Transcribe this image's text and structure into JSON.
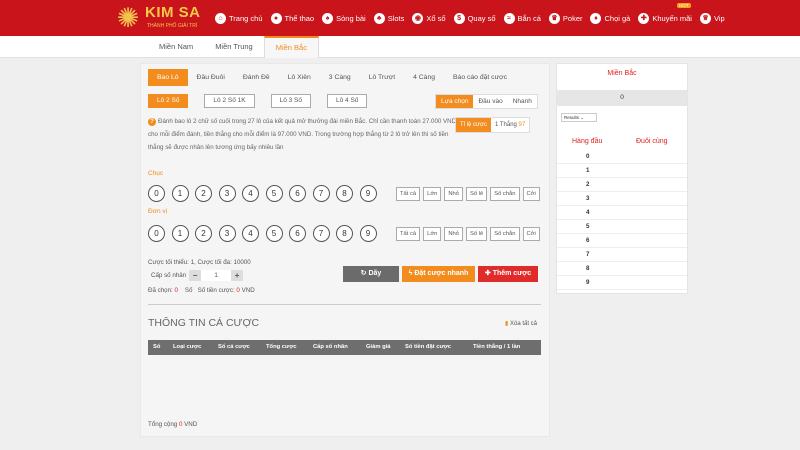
{
  "header": {
    "brand": "KIM SA",
    "tagline": "THÀNH PHỐ GIẢI TRÍ",
    "hot_badge": "HOT",
    "nav": [
      {
        "label": "Trang chủ",
        "icon": "home-icon"
      },
      {
        "label": "Thể thao",
        "icon": "soccer-ball-icon"
      },
      {
        "label": "Sòng bài",
        "icon": "cards-icon"
      },
      {
        "label": "Slots",
        "icon": "cherry-icon"
      },
      {
        "label": "Xổ số",
        "icon": "lottery-ball-icon"
      },
      {
        "label": "Quay số",
        "icon": "dollar-coin-icon"
      },
      {
        "label": "Bắn cá",
        "icon": "fish-icon"
      },
      {
        "label": "Poker",
        "icon": "crown-icon"
      },
      {
        "label": "Chọi gà",
        "icon": "rooster-icon"
      },
      {
        "label": "Khuyến mãi",
        "icon": "gift-icon"
      },
      {
        "label": "Vip",
        "icon": "vip-crown-icon"
      }
    ]
  },
  "regions": [
    "Miền Nam",
    "Miền Trung",
    "Miền Bắc"
  ],
  "bet_tabs": [
    "Bao Lô",
    "Đầu Đuôi",
    "Đánh Đề",
    "Lô Xiên",
    "3 Càng",
    "Lô Trượt",
    "4 Càng",
    "Báo cáo đặt cược"
  ],
  "sub_buttons": [
    "Lô 2 Số",
    "Lô 2 Số 1K",
    "Lô 3 Số",
    "Lô 4 Số"
  ],
  "mode_buttons": [
    "Lựa chọn",
    "Đầu vào",
    "Nhanh"
  ],
  "description": "Đánh bao lô 2 chữ số cuối trong 27 lô của kết quả mở thưởng đài miền Bắc. Chỉ cần thanh toán 27.000 VND cho mỗi điểm đánh, tiền thắng cho mỗi điểm là 97.000 VND. Trong trường hợp thắng từ 2 lô trở lên thì số tiền thắng sẽ được nhân lên tương ứng bấy nhiêu lần",
  "odds": {
    "label": "Tỉ lệ cược",
    "text": "1 Thắng",
    "value": "97"
  },
  "rows": [
    {
      "label": "Chục"
    },
    {
      "label": "Đơn vị"
    }
  ],
  "digits": [
    "0",
    "1",
    "2",
    "3",
    "4",
    "5",
    "6",
    "7",
    "8",
    "9"
  ],
  "quick": [
    "Tất cả",
    "Lớn",
    "Nhỏ",
    "Số lẻ",
    "Số chẵn",
    "Cởi"
  ],
  "limits": "Cược tối thiểu: 1, Cược tối đa: 10000",
  "multiplier": {
    "label": "Cấp số nhân",
    "value": "1",
    "minus": "−",
    "plus": "+"
  },
  "summary": {
    "chosen_label": "Đã chọn:",
    "chosen": "0",
    "count_label": "Số",
    "amount_label": "Số tiền cược:",
    "amount": "0",
    "unit": "VND"
  },
  "actions": {
    "clear": "Dãy",
    "quick_bet": "Đặt cược nhanh",
    "add_bet": "Thêm cược"
  },
  "bet_info": {
    "title": "THÔNG TIN CÁ CƯỢC",
    "delete_all": "Xóa tất cả",
    "columns": [
      "Số",
      "Loại cược",
      "Số cá cược",
      "Tổng cược",
      "Cấp số nhân",
      "Giảm giá",
      "Số tiền đặt cược",
      "Tiền thắng / 1 lần"
    ],
    "total_label": "Tổng cộng",
    "total": "0",
    "unit": "VND"
  },
  "side": {
    "title": "Miền Bắc",
    "zero": "0",
    "select": "Results",
    "head_col": "Hàng đầu",
    "tail_col": "Đuôi cùng",
    "rows": [
      "0",
      "1",
      "2",
      "3",
      "4",
      "5",
      "6",
      "7",
      "8",
      "9"
    ]
  }
}
